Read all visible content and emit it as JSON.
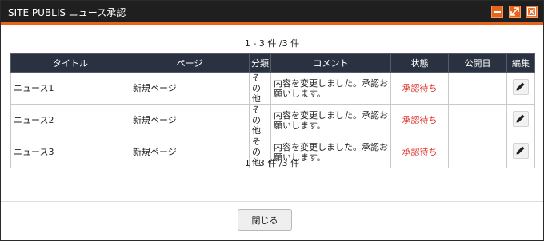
{
  "window": {
    "title": "SITE PUBLIS ニュース承認"
  },
  "pagination": {
    "top": "1 - 3 件 /3 件",
    "bottom": "1 - 3 件 /3 件"
  },
  "table": {
    "headers": {
      "title": "タイトル",
      "page": "ページ",
      "category": "分類",
      "comment": "コメント",
      "status": "状態",
      "published": "公開日",
      "edit": "編集"
    },
    "rows": [
      {
        "title": "ニュース1",
        "page": "新規ページ",
        "category": "その他",
        "comment": "内容を変更しました。承認お願いします。",
        "status": "承認待ち",
        "published": ""
      },
      {
        "title": "ニュース2",
        "page": "新規ページ",
        "category": "その他",
        "comment": "内容を変更しました。承認お願いします。",
        "status": "承認待ち",
        "published": ""
      },
      {
        "title": "ニュース3",
        "page": "新規ページ",
        "category": "その他",
        "comment": "内容を変更しました。承認お願いします。",
        "status": "承認待ち",
        "published": ""
      }
    ]
  },
  "footer": {
    "close_label": "閉じる"
  },
  "colors": {
    "titlebar": "#1f1f1f",
    "accent": "#e8641b",
    "header_bg": "#2a3140",
    "status": "#e0322b"
  },
  "icons": {
    "minimize": "minimize-icon",
    "maximize": "maximize-icon",
    "close": "close-icon",
    "edit": "pencil-icon"
  }
}
